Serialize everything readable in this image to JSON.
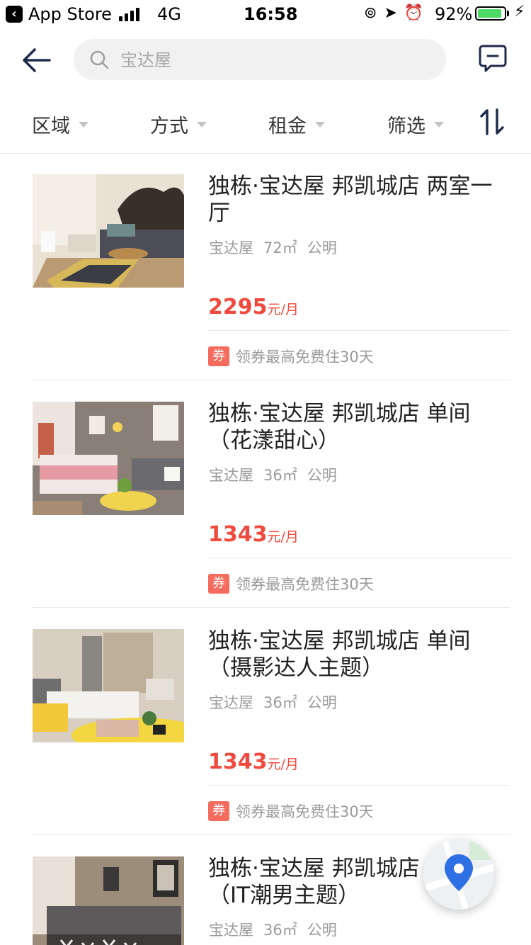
{
  "status_bar": {
    "back_app": "App Store",
    "network": "4G",
    "time": "16:58",
    "battery": "92%",
    "battery_level": 0.92
  },
  "search": {
    "placeholder": "宝达屋"
  },
  "filters": [
    {
      "label": "区域"
    },
    {
      "label": "方式"
    },
    {
      "label": "租金"
    },
    {
      "label": "筛选"
    }
  ],
  "listings": [
    {
      "title": "独栋·宝达屋 邦凯城店 两室一厅",
      "brand": "宝达屋",
      "area": "72㎡",
      "district": "公明",
      "price": "2295",
      "price_unit": "元/月",
      "coupon_badge": "券",
      "coupon_text": "领券最高免费住30天"
    },
    {
      "title": "独栋·宝达屋 邦凯城店 单间（花漾甜心）",
      "brand": "宝达屋",
      "area": "36㎡",
      "district": "公明",
      "price": "1343",
      "price_unit": "元/月",
      "coupon_badge": "券",
      "coupon_text": "领券最高免费住30天"
    },
    {
      "title": "独栋·宝达屋 邦凯城店 单间（摄影达人主题）",
      "brand": "宝达屋",
      "area": "36㎡",
      "district": "公明",
      "price": "1343",
      "price_unit": "元/月",
      "coupon_badge": "券",
      "coupon_text": "领券最高免费住30天"
    },
    {
      "title": "独栋·宝达屋 邦凯城店 单间（IT潮男主题）",
      "brand": "宝达屋",
      "area": "36㎡",
      "district": "公明",
      "price": "",
      "price_unit": "",
      "coupon_badge": "",
      "coupon_text": ""
    }
  ],
  "colors": {
    "price": "#f04a3e",
    "coupon": "#f56b5e",
    "nav_icon": "#1e2a4a",
    "map_pin": "#2f6fe4"
  },
  "icons": [
    "back-arrow-icon",
    "search-icon",
    "message-icon",
    "sort-icon",
    "map-pin-icon"
  ]
}
